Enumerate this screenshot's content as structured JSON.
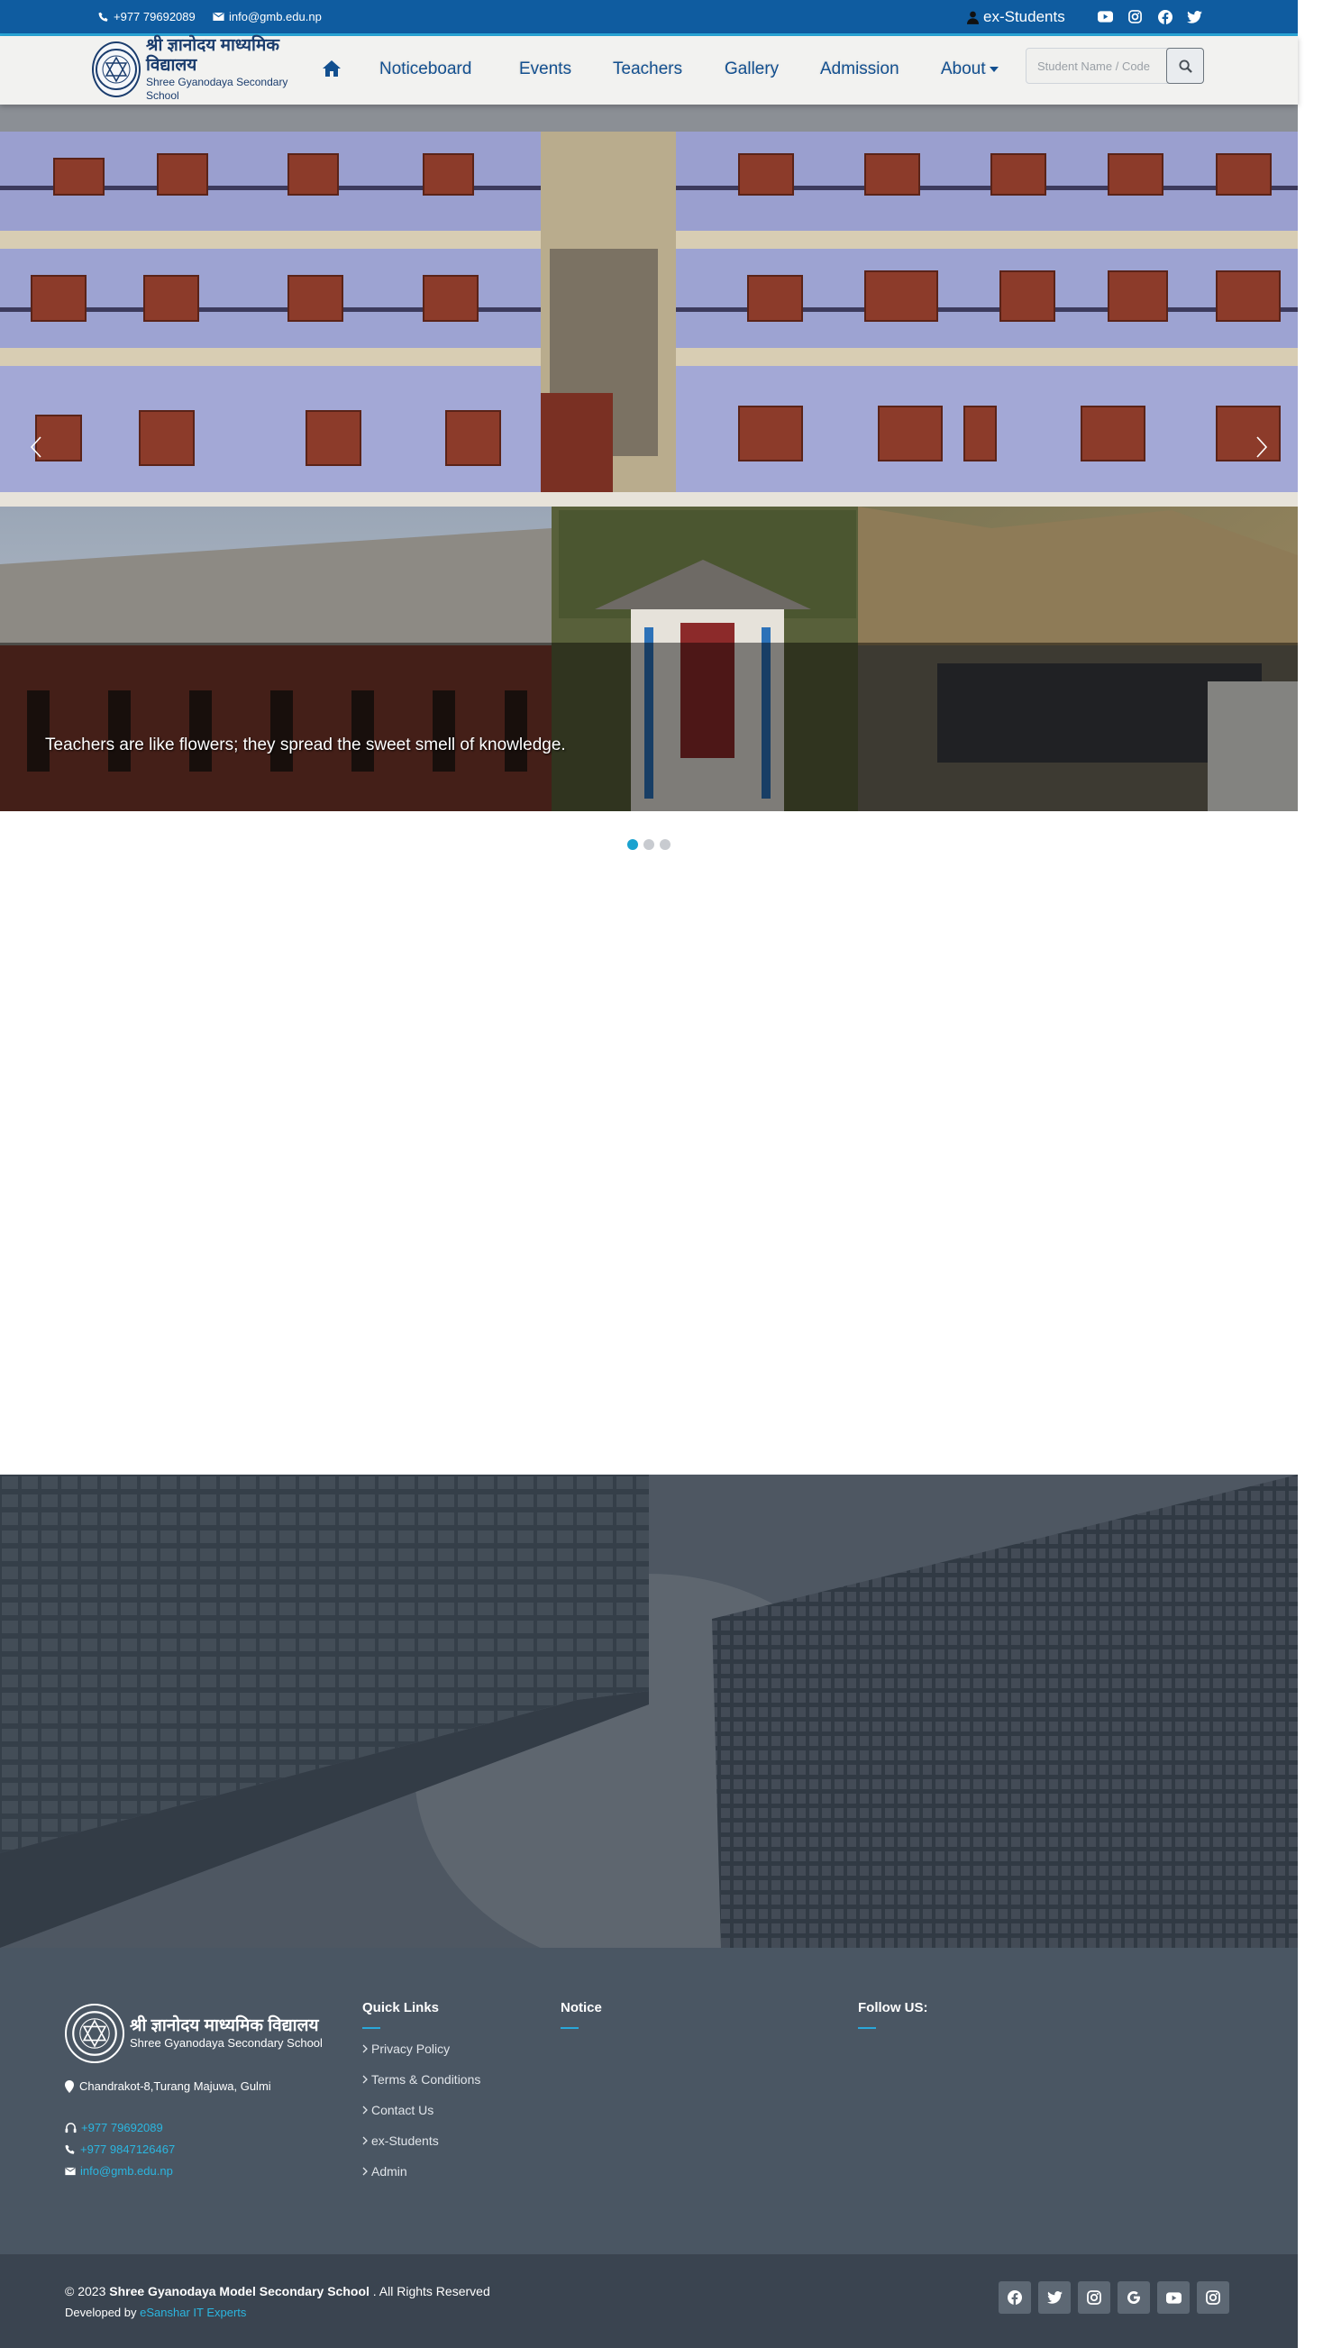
{
  "topbar": {
    "phone": "+977 79692089",
    "email": "info@gmb.edu.np",
    "ex_students": "ex-Students",
    "social_icons": [
      "youtube-icon",
      "instagram-icon",
      "facebook-icon",
      "twitter-icon"
    ]
  },
  "logo": {
    "nepali_name": "श्री ज्ञानोदय माध्यमिक विद्यालय",
    "english_name": "Shree Gyanodaya Secondary School"
  },
  "nav": {
    "items": [
      "Noticeboard",
      "Events",
      "Teachers",
      "Gallery",
      "Admission",
      "About"
    ],
    "search_placeholder": "Student Name / Code"
  },
  "slider": {
    "caption": "Teachers are like flowers; they spread the sweet smell of knowledge.",
    "slide_count": 3,
    "active_slide": 1
  },
  "footer": {
    "address": "Chandrakot-8,Turang Majuwa, Gulmi",
    "phone1": "+977 79692089",
    "phone2": "+977 9847126467",
    "email": "info@gmb.edu.np",
    "quick_links_title": "Quick Links",
    "quick_links": [
      "Privacy Policy",
      "Terms & Conditions",
      "Contact Us",
      "ex-Students",
      "Admin"
    ],
    "notice_title": "Notice",
    "follow_title": "Follow US:"
  },
  "copyright": {
    "prefix": "© 2023",
    "school": "Shree Gyanodaya Model Secondary School",
    "suffix": ". All Rights Reserved",
    "developed_by": "Developed by",
    "developer": "eSanshar IT Experts",
    "social_icons": [
      "facebook-icon",
      "twitter-icon",
      "instagram-icon",
      "google-icon",
      "youtube-icon",
      "instagram-icon"
    ]
  },
  "colors": {
    "topbar": "#0f5ca0",
    "accent": "#2aa7d9",
    "nav_text": "#124f8f",
    "footer": "#4a5663",
    "copybar": "#3a4450"
  }
}
